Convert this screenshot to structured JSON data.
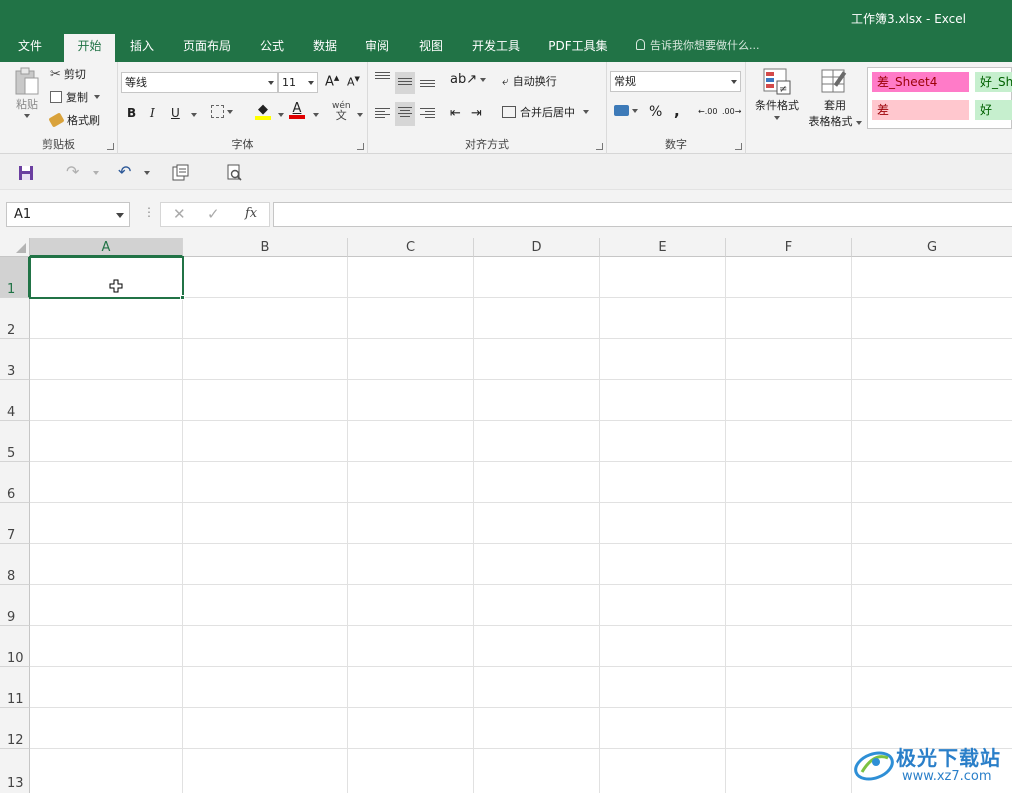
{
  "window": {
    "title": "工作簿3.xlsx - Excel"
  },
  "tabs": [
    "文件",
    "开始",
    "插入",
    "页面布局",
    "公式",
    "数据",
    "审阅",
    "视图",
    "开发工具",
    "PDF工具集"
  ],
  "active_tab": "开始",
  "tell_me": "告诉我你想要做什么...",
  "ribbon": {
    "clipboard": {
      "label": "剪贴板",
      "paste": "粘贴",
      "cut": "剪切",
      "copy": "复制",
      "format_painter": "格式刷"
    },
    "font": {
      "label": "字体",
      "name": "等线",
      "size": "11",
      "bold": "B",
      "italic": "I",
      "underline": "U",
      "font_color_letter": "A",
      "phonetic": "wén"
    },
    "alignment": {
      "label": "对齐方式",
      "wrap": "自动换行",
      "merge": "合并后居中"
    },
    "number": {
      "label": "数字",
      "format": "常规",
      "percent": "%",
      "comma": ",",
      "inc_decimal": ".00",
      "dec_decimal": ".00"
    },
    "styles": {
      "conditional": "条件格式",
      "table_line1": "套用",
      "table_line2": "表格格式",
      "cells": [
        "差_Sheet4",
        "好_Sh",
        "差",
        "好"
      ]
    }
  },
  "namebox": "A1",
  "fx_label": "fx",
  "columns": [
    "A",
    "B",
    "C",
    "D",
    "E",
    "F",
    "G"
  ],
  "rows": [
    "1",
    "2",
    "3",
    "4",
    "5",
    "6",
    "7",
    "8",
    "9",
    "10",
    "11",
    "12",
    "13"
  ],
  "watermark": {
    "text": "极光下载站",
    "url": "www.xz7.com"
  },
  "colors": {
    "accent": "#217346",
    "bad_fill": "#ffc7ce",
    "bad_text": "#9c0006",
    "good_fill": "#c6efce",
    "good_text": "#006100",
    "bad_sheet_fill": "#ff7bc8"
  }
}
